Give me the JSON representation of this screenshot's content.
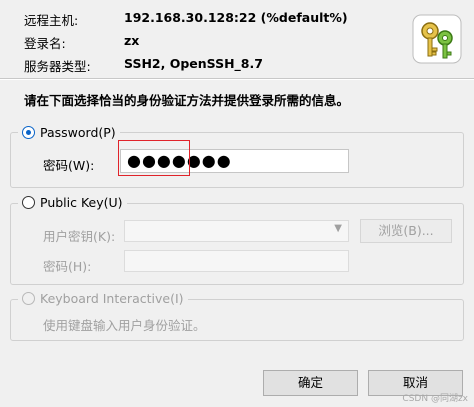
{
  "host_info": {
    "remote_host_label": "远程主机:",
    "remote_host_value": "192.168.30.128:22 (%default%)",
    "login_name_label": "登录名:",
    "login_name_value": "zx",
    "server_type_label": "服务器类型:",
    "server_type_value": "SSH2, OpenSSH_8.7"
  },
  "instruction": "请在下面选择恰当的身份验证方法并提供登录所需的信息。",
  "password_method": {
    "label": "Password(P)",
    "password_label": "密码(W):",
    "password_value": "●●●●●●●",
    "selected": true
  },
  "public_key_method": {
    "label": "Public Key(U)",
    "user_key_label": "用户密钥(K):",
    "browse_button": "浏览(B)...",
    "passphrase_label": "密码(H):"
  },
  "keyboard_method": {
    "label": "Keyboard Interactive(I)",
    "description": "使用键盘输入用户身份验证。"
  },
  "buttons": {
    "ok": "确定",
    "cancel": "取消"
  },
  "watermark": "CSDN @同湖zx",
  "icon": "keys-icon",
  "colors": {
    "highlight": "#e0232a",
    "radio_selected": "#0a64c8"
  }
}
